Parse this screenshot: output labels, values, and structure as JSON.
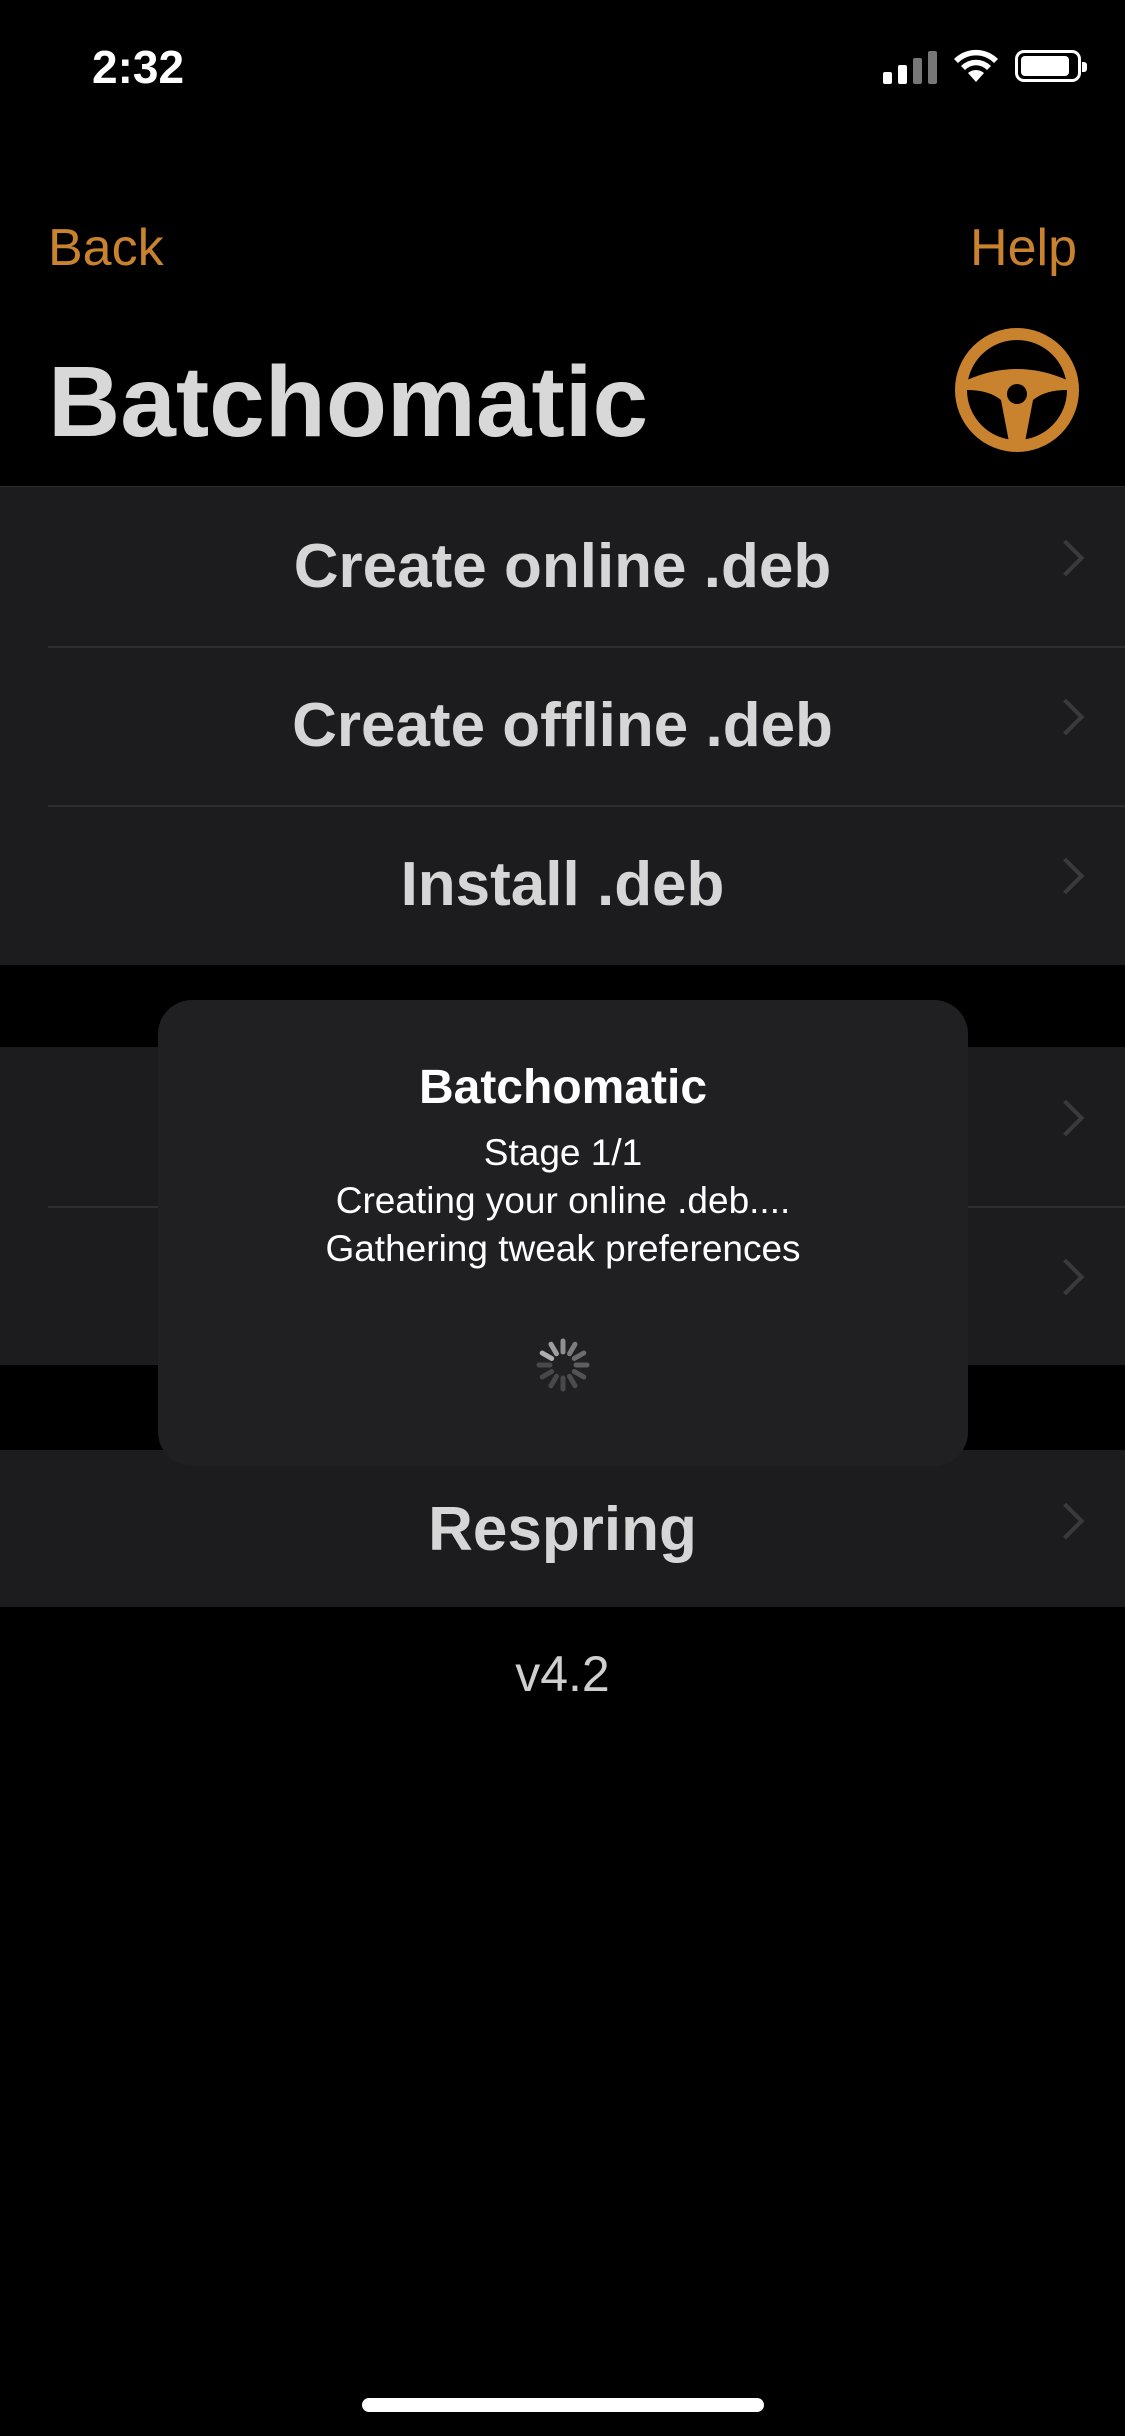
{
  "status_bar": {
    "time": "2:32"
  },
  "nav": {
    "back_label": "Back",
    "help_label": "Help"
  },
  "title": "Batchomatic",
  "logo": {
    "icon": "steering-wheel-icon",
    "color": "#c9822e"
  },
  "menu": {
    "group1": [
      {
        "label": "Create online .deb"
      },
      {
        "label": "Create offline .deb"
      },
      {
        "label": "Install .deb"
      }
    ],
    "group2": [
      {
        "label": ""
      },
      {
        "label": ""
      }
    ],
    "group3": [
      {
        "label": "Respring"
      }
    ]
  },
  "version": "v4.2",
  "hud": {
    "title": "Batchomatic",
    "lines": [
      "Stage 1/1",
      "Creating your online .deb....",
      "Gathering tweak preferences"
    ]
  },
  "colors": {
    "accent": "#c9822e",
    "background": "#000000",
    "cell": "#1c1c1e"
  }
}
